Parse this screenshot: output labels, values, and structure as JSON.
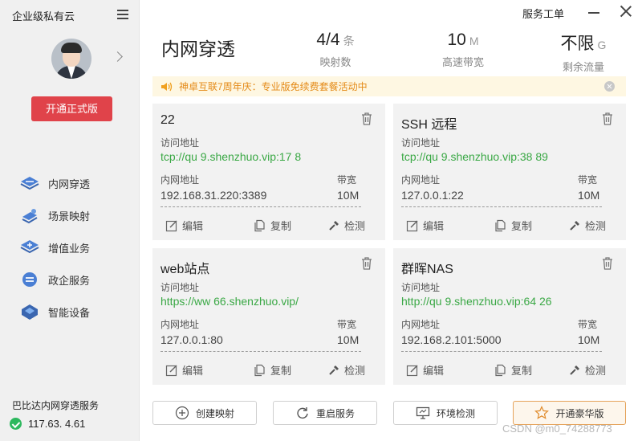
{
  "app": {
    "brand": "企业级私有云",
    "upgrade_label": "开通正式版",
    "service_title": "巴比达内网穿透服务",
    "service_ip": "117.63.  4.61"
  },
  "sidebar": {
    "items": [
      {
        "label": "内网穿透",
        "icon": "tunnel-icon"
      },
      {
        "label": "场景映射",
        "icon": "scene-map-icon"
      },
      {
        "label": "增值业务",
        "icon": "value-added-icon"
      },
      {
        "label": "政企服务",
        "icon": "gov-enterprise-icon"
      },
      {
        "label": "智能设备",
        "icon": "smart-device-icon"
      }
    ]
  },
  "topbar": {
    "service_ticket": "服务工单"
  },
  "header": {
    "title": "内网穿透",
    "stats": [
      {
        "value": "4/4",
        "unit": "条",
        "label": "映射数"
      },
      {
        "value": "10",
        "unit": "M",
        "label": "高速带宽"
      },
      {
        "value": "不限",
        "unit": "G",
        "label": "剩余流量"
      }
    ]
  },
  "notice": {
    "text": "神卓互联7周年庆：专业版免续费套餐活动中"
  },
  "labels": {
    "access": "访问地址",
    "lan": "内网地址",
    "bandwidth": "带宽",
    "edit": "编辑",
    "copy": "复制",
    "check": "检测"
  },
  "cards": [
    {
      "name": "22",
      "url": "tcp://qu   9.shenzhuo.vip:17  8",
      "lan": "192.168.31.220:3389",
      "bandwidth": "10M"
    },
    {
      "name": "SSH 远程",
      "url": "tcp://qu   9.shenzhuo.vip:38  89",
      "lan": "127.0.0.1:22",
      "bandwidth": "10M"
    },
    {
      "name": "web站点",
      "url": "https://ww   66.shenzhuo.vip/",
      "lan": "127.0.0.1:80",
      "bandwidth": "10M"
    },
    {
      "name": "群晖NAS",
      "url": "http://qu   9.shenzhuo.vip:64  26",
      "lan": "192.168.2.101:5000",
      "bandwidth": "10M"
    }
  ],
  "bottom": {
    "create": "创建映射",
    "restart": "重启服务",
    "env_check": "环境检测",
    "premium": "开通豪华版"
  },
  "watermark": "CSDN @m0_74288773",
  "colors": {
    "accent_red": "#e0434a",
    "link_green": "#3aa845",
    "notice_orange": "#e48a17",
    "status_green": "#2db85e"
  }
}
